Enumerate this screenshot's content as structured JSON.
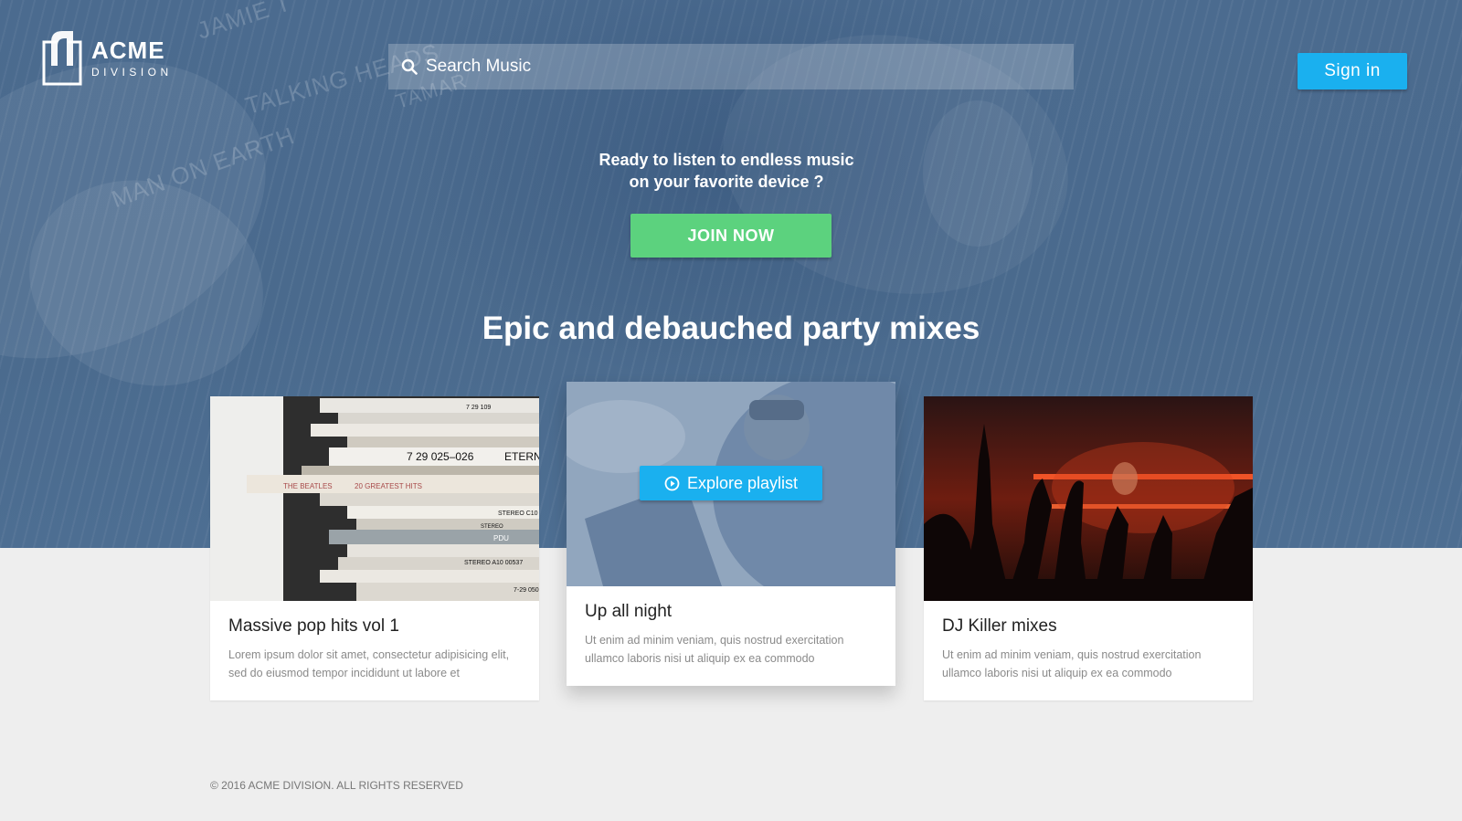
{
  "brand": {
    "name": "ACME",
    "sub": "DIVISION"
  },
  "search": {
    "placeholder": "Search Music"
  },
  "header": {
    "signin_label": "Sign in"
  },
  "hero": {
    "tagline_line1": "Ready to listen to endless music",
    "tagline_line2": "on your favorite device ?",
    "join_label": "JOIN NOW"
  },
  "hero_background_text": [
    "JAMIE T",
    "TALKING HEADS",
    "TAMAR",
    "MAN ON EARTH"
  ],
  "section": {
    "title": "Epic and debauched party mixes"
  },
  "cards": [
    {
      "title": "Massive pop hits vol 1",
      "text": "Lorem ipsum dolor sit amet, consectetur adipisicing elit, sed do eiusmod tempor incididunt ut labore et",
      "image_labels": [
        "7 29 109",
        "7 29 025–026",
        "ETERN",
        "THE BEATLES",
        "20 GREATEST HITS",
        "STEREO C10",
        "STEREO",
        "PDU",
        "STEREO A10 00537",
        "7-29 050"
      ]
    },
    {
      "title": "Up all night",
      "text": "Ut enim ad minim veniam, quis nostrud exercitation ullamco laboris nisi ut aliquip ex ea commodo",
      "explore_label": "Explore playlist"
    },
    {
      "title": "DJ Killer mixes",
      "text": "Ut enim ad minim veniam, quis nostrud exercitation ullamco laboris nisi ut aliquip ex ea commodo"
    }
  ],
  "footer": {
    "copyright": "© 2016 ACME DIVISION. ALL RIGHTS RESERVED"
  },
  "colors": {
    "accent": "#1ab0ef",
    "join": "#5cd27e",
    "hero": "#4a6a8d",
    "page_bg": "#eeeeee"
  }
}
